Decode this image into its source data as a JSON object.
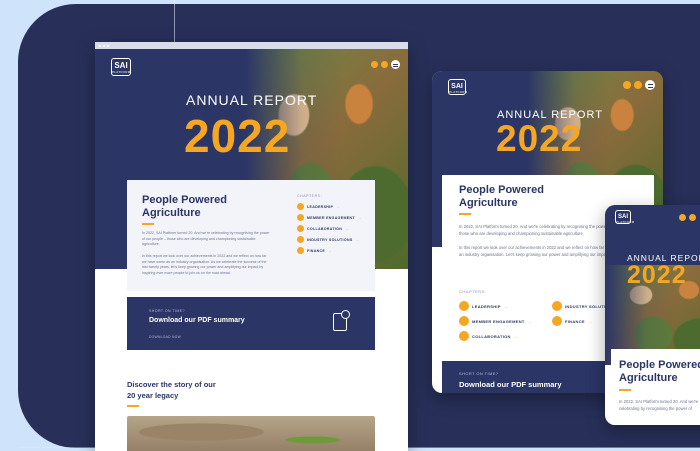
{
  "report": {
    "logo": "SAI",
    "logo_sub": "PLATFORM",
    "kicker": "ANNUAL REPORT",
    "year": "2022",
    "title_line1": "People Powered",
    "title_line2": "Agriculture",
    "intro": "In 2022, SAI Platform turned 20. And we're celebrating by recognising the power of our people – those who are developing and championing sustainable agriculture.",
    "intro2": "In this report we look over our achievements in 2022 and we reflect on how far we have come as an industry organisation. As we celebrate the success of the last twenty years, let's keep growing our power and amplifying our impact by inspiring ever more people to join us on the road ahead.",
    "chapters_label": "CHAPTERS:",
    "chapters": [
      "LEADERSHIP",
      "MEMBER ENGAGEMENT",
      "COLLABORATION",
      "INDUSTRY SOLUTIONS",
      "FINANCE"
    ]
  },
  "pdf": {
    "kicker": "SHORT ON TIME?",
    "title": "Download our PDF summary",
    "cta": "DOWNLOAD NOW"
  },
  "story": {
    "line1": "Discover the story of our",
    "line2": "20 year legacy"
  },
  "tablet": {
    "intro_short": "In 2022, SAI Platform turned 20. And we're celebrating by recognising the power of our people – those who are developing and championing sustainable agriculture.",
    "intro2_short": "In this report we look over our achievements in 2022 and we reflect on how far we have come as an industry organisation. Let's keep growing our power and amplifying our impact."
  },
  "phone": {
    "intro_short": "In 2022, SAI Platform turned 20. And we're celebrating by recognising the power of"
  },
  "colors": {
    "navy": "#2b3566",
    "accent": "#f5a623",
    "background": "#cfe3fb"
  }
}
